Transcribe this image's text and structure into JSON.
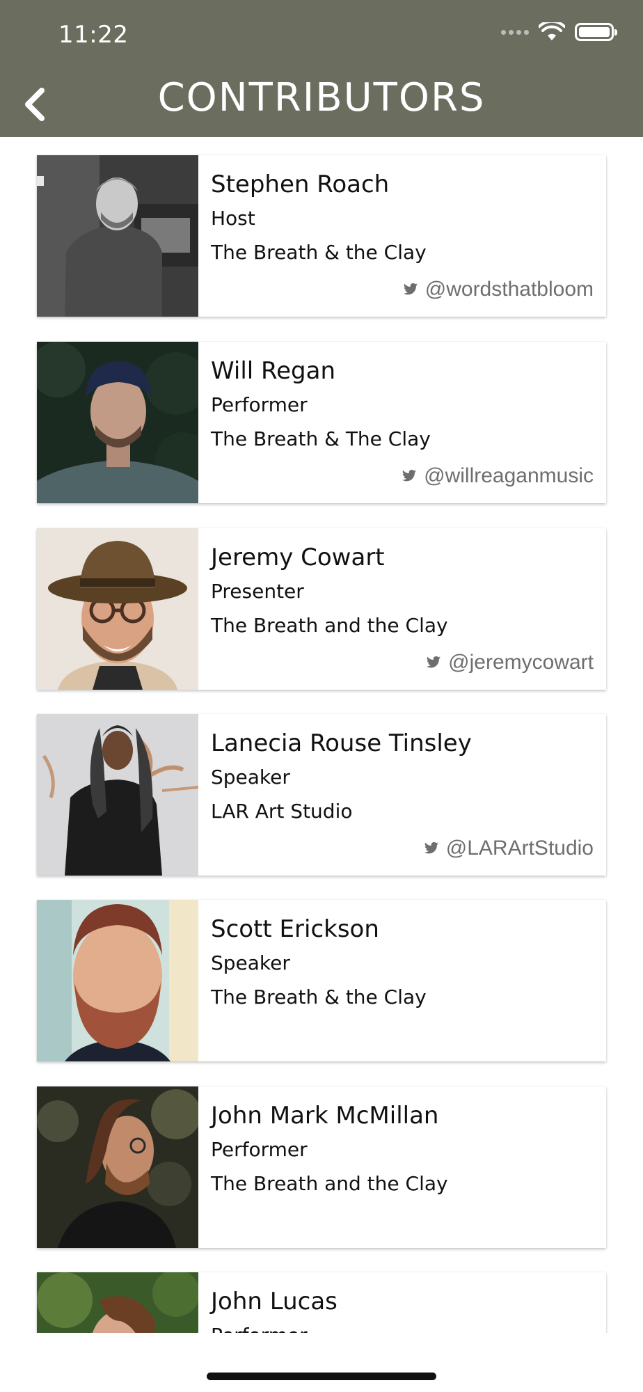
{
  "status_bar": {
    "time": "11:22"
  },
  "header": {
    "title": "CONTRIBUTORS"
  },
  "contributors": [
    {
      "name": "Stephen Roach",
      "role": "Host",
      "org": "The Breath & the Clay",
      "handle": "@wordsthatbloom"
    },
    {
      "name": "Will Regan",
      "role": "Performer",
      "org": "The Breath & The Clay",
      "handle": "@willreaganmusic"
    },
    {
      "name": "Jeremy Cowart",
      "role": "Presenter",
      "org": "The Breath and the Clay",
      "handle": "@jeremycowart"
    },
    {
      "name": "Lanecia Rouse Tinsley",
      "role": "Speaker",
      "org": "LAR Art Studio",
      "handle": "@LARArtStudio"
    },
    {
      "name": "Scott Erickson",
      "role": "Speaker",
      "org": "The Breath & the Clay",
      "handle": ""
    },
    {
      "name": "John Mark McMillan",
      "role": "Performer",
      "org": "The Breath and the Clay",
      "handle": ""
    },
    {
      "name": "John Lucas",
      "role": "Performer",
      "org": "",
      "handle": ""
    }
  ],
  "colors": {
    "header_bg": "#6b6e5e",
    "handle_text": "#6e6e6e"
  },
  "icons": {
    "back": "chevron-left-icon",
    "handle": "twitter-bird-icon"
  }
}
